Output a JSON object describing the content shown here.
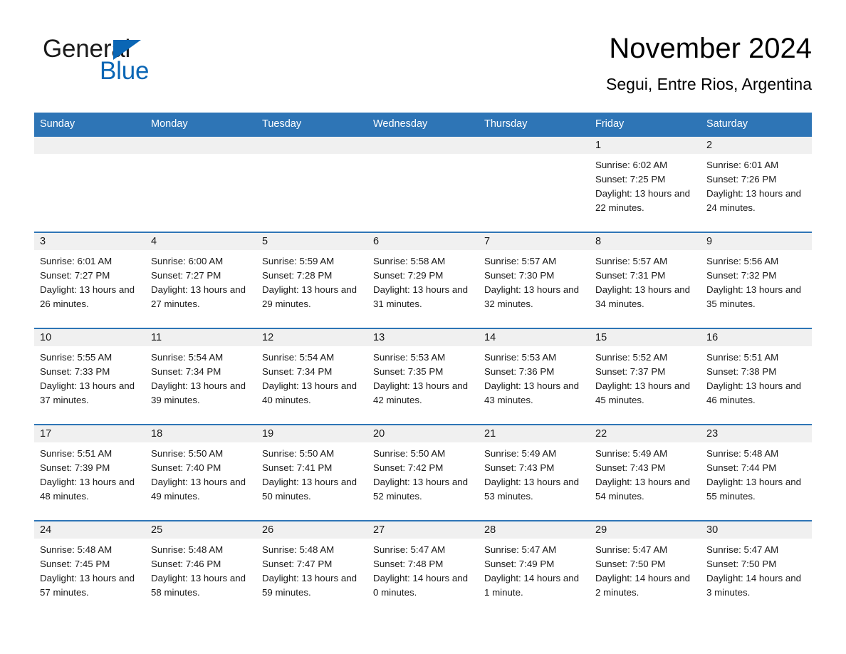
{
  "brand": {
    "name_part1": "General",
    "name_part2": "Blue",
    "triangle_color": "#0a66b5",
    "icon": "triangle-logo-icon"
  },
  "header": {
    "month_title": "November 2024",
    "location": "Segui, Entre Rios, Argentina"
  },
  "theme": {
    "header_blue": "#2e75b6",
    "daystrip_gray": "#f0f0f0",
    "text_color": "#1a1a1a",
    "page_background": "#ffffff"
  },
  "weekday_headers": [
    "Sunday",
    "Monday",
    "Tuesday",
    "Wednesday",
    "Thursday",
    "Friday",
    "Saturday"
  ],
  "weeks": [
    [
      {
        "day": "",
        "sunrise": "",
        "sunset": "",
        "daylight": "",
        "empty": true
      },
      {
        "day": "",
        "sunrise": "",
        "sunset": "",
        "daylight": "",
        "empty": true
      },
      {
        "day": "",
        "sunrise": "",
        "sunset": "",
        "daylight": "",
        "empty": true
      },
      {
        "day": "",
        "sunrise": "",
        "sunset": "",
        "daylight": "",
        "empty": true
      },
      {
        "day": "",
        "sunrise": "",
        "sunset": "",
        "daylight": "",
        "empty": true
      },
      {
        "day": "1",
        "sunrise": "Sunrise: 6:02 AM",
        "sunset": "Sunset: 7:25 PM",
        "daylight": "Daylight: 13 hours and 22 minutes."
      },
      {
        "day": "2",
        "sunrise": "Sunrise: 6:01 AM",
        "sunset": "Sunset: 7:26 PM",
        "daylight": "Daylight: 13 hours and 24 minutes."
      }
    ],
    [
      {
        "day": "3",
        "sunrise": "Sunrise: 6:01 AM",
        "sunset": "Sunset: 7:27 PM",
        "daylight": "Daylight: 13 hours and 26 minutes."
      },
      {
        "day": "4",
        "sunrise": "Sunrise: 6:00 AM",
        "sunset": "Sunset: 7:27 PM",
        "daylight": "Daylight: 13 hours and 27 minutes."
      },
      {
        "day": "5",
        "sunrise": "Sunrise: 5:59 AM",
        "sunset": "Sunset: 7:28 PM",
        "daylight": "Daylight: 13 hours and 29 minutes."
      },
      {
        "day": "6",
        "sunrise": "Sunrise: 5:58 AM",
        "sunset": "Sunset: 7:29 PM",
        "daylight": "Daylight: 13 hours and 31 minutes."
      },
      {
        "day": "7",
        "sunrise": "Sunrise: 5:57 AM",
        "sunset": "Sunset: 7:30 PM",
        "daylight": "Daylight: 13 hours and 32 minutes."
      },
      {
        "day": "8",
        "sunrise": "Sunrise: 5:57 AM",
        "sunset": "Sunset: 7:31 PM",
        "daylight": "Daylight: 13 hours and 34 minutes."
      },
      {
        "day": "9",
        "sunrise": "Sunrise: 5:56 AM",
        "sunset": "Sunset: 7:32 PM",
        "daylight": "Daylight: 13 hours and 35 minutes."
      }
    ],
    [
      {
        "day": "10",
        "sunrise": "Sunrise: 5:55 AM",
        "sunset": "Sunset: 7:33 PM",
        "daylight": "Daylight: 13 hours and 37 minutes."
      },
      {
        "day": "11",
        "sunrise": "Sunrise: 5:54 AM",
        "sunset": "Sunset: 7:34 PM",
        "daylight": "Daylight: 13 hours and 39 minutes."
      },
      {
        "day": "12",
        "sunrise": "Sunrise: 5:54 AM",
        "sunset": "Sunset: 7:34 PM",
        "daylight": "Daylight: 13 hours and 40 minutes."
      },
      {
        "day": "13",
        "sunrise": "Sunrise: 5:53 AM",
        "sunset": "Sunset: 7:35 PM",
        "daylight": "Daylight: 13 hours and 42 minutes."
      },
      {
        "day": "14",
        "sunrise": "Sunrise: 5:53 AM",
        "sunset": "Sunset: 7:36 PM",
        "daylight": "Daylight: 13 hours and 43 minutes."
      },
      {
        "day": "15",
        "sunrise": "Sunrise: 5:52 AM",
        "sunset": "Sunset: 7:37 PM",
        "daylight": "Daylight: 13 hours and 45 minutes."
      },
      {
        "day": "16",
        "sunrise": "Sunrise: 5:51 AM",
        "sunset": "Sunset: 7:38 PM",
        "daylight": "Daylight: 13 hours and 46 minutes."
      }
    ],
    [
      {
        "day": "17",
        "sunrise": "Sunrise: 5:51 AM",
        "sunset": "Sunset: 7:39 PM",
        "daylight": "Daylight: 13 hours and 48 minutes."
      },
      {
        "day": "18",
        "sunrise": "Sunrise: 5:50 AM",
        "sunset": "Sunset: 7:40 PM",
        "daylight": "Daylight: 13 hours and 49 minutes."
      },
      {
        "day": "19",
        "sunrise": "Sunrise: 5:50 AM",
        "sunset": "Sunset: 7:41 PM",
        "daylight": "Daylight: 13 hours and 50 minutes."
      },
      {
        "day": "20",
        "sunrise": "Sunrise: 5:50 AM",
        "sunset": "Sunset: 7:42 PM",
        "daylight": "Daylight: 13 hours and 52 minutes."
      },
      {
        "day": "21",
        "sunrise": "Sunrise: 5:49 AM",
        "sunset": "Sunset: 7:43 PM",
        "daylight": "Daylight: 13 hours and 53 minutes."
      },
      {
        "day": "22",
        "sunrise": "Sunrise: 5:49 AM",
        "sunset": "Sunset: 7:43 PM",
        "daylight": "Daylight: 13 hours and 54 minutes."
      },
      {
        "day": "23",
        "sunrise": "Sunrise: 5:48 AM",
        "sunset": "Sunset: 7:44 PM",
        "daylight": "Daylight: 13 hours and 55 minutes."
      }
    ],
    [
      {
        "day": "24",
        "sunrise": "Sunrise: 5:48 AM",
        "sunset": "Sunset: 7:45 PM",
        "daylight": "Daylight: 13 hours and 57 minutes."
      },
      {
        "day": "25",
        "sunrise": "Sunrise: 5:48 AM",
        "sunset": "Sunset: 7:46 PM",
        "daylight": "Daylight: 13 hours and 58 minutes."
      },
      {
        "day": "26",
        "sunrise": "Sunrise: 5:48 AM",
        "sunset": "Sunset: 7:47 PM",
        "daylight": "Daylight: 13 hours and 59 minutes."
      },
      {
        "day": "27",
        "sunrise": "Sunrise: 5:47 AM",
        "sunset": "Sunset: 7:48 PM",
        "daylight": "Daylight: 14 hours and 0 minutes."
      },
      {
        "day": "28",
        "sunrise": "Sunrise: 5:47 AM",
        "sunset": "Sunset: 7:49 PM",
        "daylight": "Daylight: 14 hours and 1 minute."
      },
      {
        "day": "29",
        "sunrise": "Sunrise: 5:47 AM",
        "sunset": "Sunset: 7:50 PM",
        "daylight": "Daylight: 14 hours and 2 minutes."
      },
      {
        "day": "30",
        "sunrise": "Sunrise: 5:47 AM",
        "sunset": "Sunset: 7:50 PM",
        "daylight": "Daylight: 14 hours and 3 minutes."
      }
    ]
  ]
}
